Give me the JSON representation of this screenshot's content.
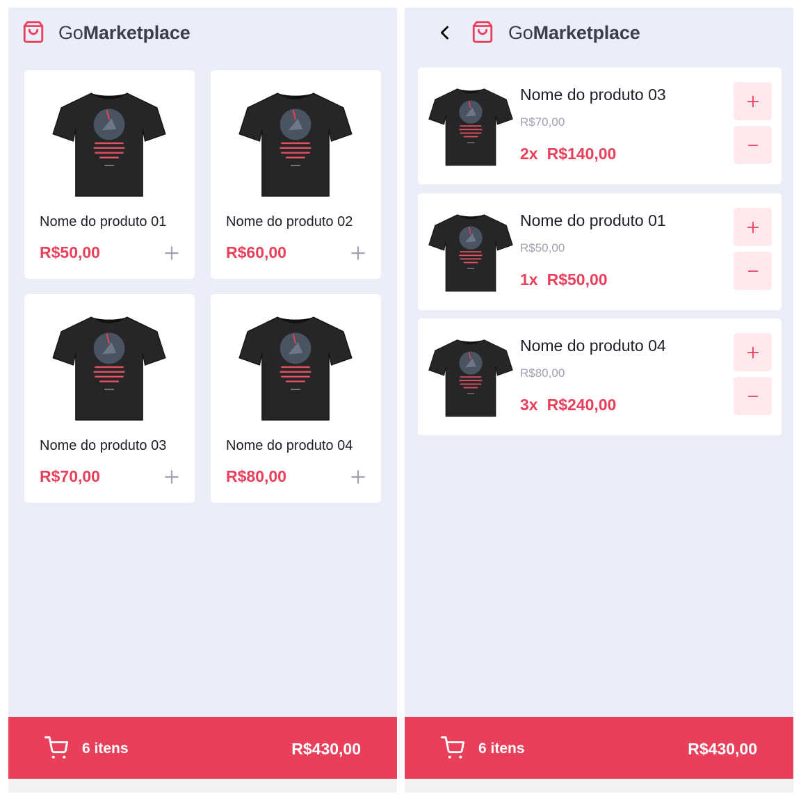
{
  "brand": {
    "prefix": "Go",
    "suffix": "Marketplace"
  },
  "colors": {
    "accent": "#e83f5b",
    "background": "#ebeef8",
    "card": "#ffffff",
    "text": "#3d3d4d",
    "muted": "#a0a0b3",
    "button_bg": "#fde8eb"
  },
  "icons": {
    "logo": "shopping-bag-icon",
    "add": "plus-icon",
    "remove": "minus-icon",
    "back": "chevron-left-icon",
    "cart": "shopping-cart-icon",
    "product_image": "black-t-shirt-image"
  },
  "products": [
    {
      "name": "Nome do produto 01",
      "price": "R$50,00"
    },
    {
      "name": "Nome do produto 02",
      "price": "R$60,00"
    },
    {
      "name": "Nome do produto 03",
      "price": "R$70,00"
    },
    {
      "name": "Nome do produto 04",
      "price": "R$80,00"
    }
  ],
  "cart": {
    "items": [
      {
        "name": "Nome do produto 03",
        "unit_price": "R$70,00",
        "quantity": "2x",
        "subtotal": "R$140,00"
      },
      {
        "name": "Nome do produto 01",
        "unit_price": "R$50,00",
        "quantity": "1x",
        "subtotal": "R$50,00"
      },
      {
        "name": "Nome do produto 04",
        "unit_price": "R$80,00",
        "quantity": "3x",
        "subtotal": "R$240,00"
      }
    ]
  },
  "footer": {
    "items_count": "6 itens",
    "total": "R$430,00"
  }
}
